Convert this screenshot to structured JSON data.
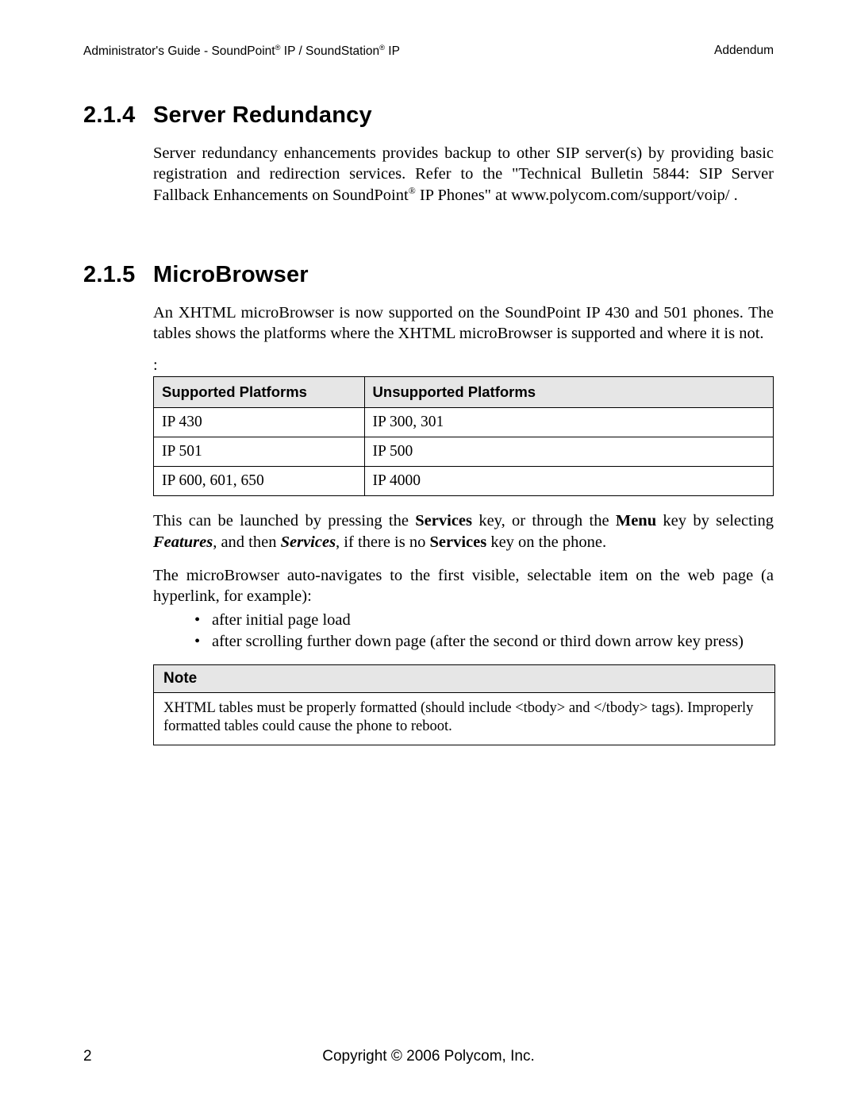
{
  "header": {
    "left_pre": "Administrator's Guide - SoundPoint",
    "left_mid": " IP / SoundStation",
    "left_post": " IP",
    "right": "Addendum"
  },
  "s214": {
    "num": "2.1.4",
    "title": "Server Redundancy",
    "p1_a": "Server redundancy enhancements provides backup to other SIP server(s) by providing basic registration and redirection services. Refer to the \"Technical Bulletin 5844: SIP Server Fallback Enhancements on SoundPoint",
    "p1_b": " IP Phones\" at www.polycom.com/support/voip/ ."
  },
  "s215": {
    "num": "2.1.5",
    "title": "MicroBrowser",
    "p1": "An XHTML microBrowser is now supported on the SoundPoint IP 430 and 501 phones. The tables shows the platforms where the XHTML microBrowser is supported and where it is not.",
    "table_lead": ":",
    "th1": "Supported Platforms",
    "th2": "Unsupported Platforms",
    "rows": [
      {
        "c1": "IP 430",
        "c2": "IP 300, 301"
      },
      {
        "c1": "IP 501",
        "c2": "IP 500"
      },
      {
        "c1": "IP 600, 601, 650",
        "c2": "IP 4000"
      }
    ],
    "p2_a": "This can be launched by pressing the ",
    "p2_services": "Services",
    "p2_b": " key, or through the ",
    "p2_menu": "Menu",
    "p2_c": " key by selecting ",
    "p2_features": "Features",
    "p2_d": ", and then ",
    "p2_services2": "Services",
    "p2_e": ", if there is no ",
    "p2_services3": "Services",
    "p2_f": " key on the phone.",
    "p3": "The microBrowser auto-navigates to the first visible, selectable item on the web page (a hyperlink, for example):",
    "li1": "after initial page load",
    "li2": "after scrolling further down page (after the second or third down arrow key press)",
    "note_title": "Note",
    "note_body": "XHTML tables must be properly formatted (should include <tbody> and </tbody> tags).  Improperly formatted tables could cause the phone to reboot."
  },
  "footer": {
    "page": "2",
    "copyright": "Copyright © 2006 Polycom, Inc."
  }
}
